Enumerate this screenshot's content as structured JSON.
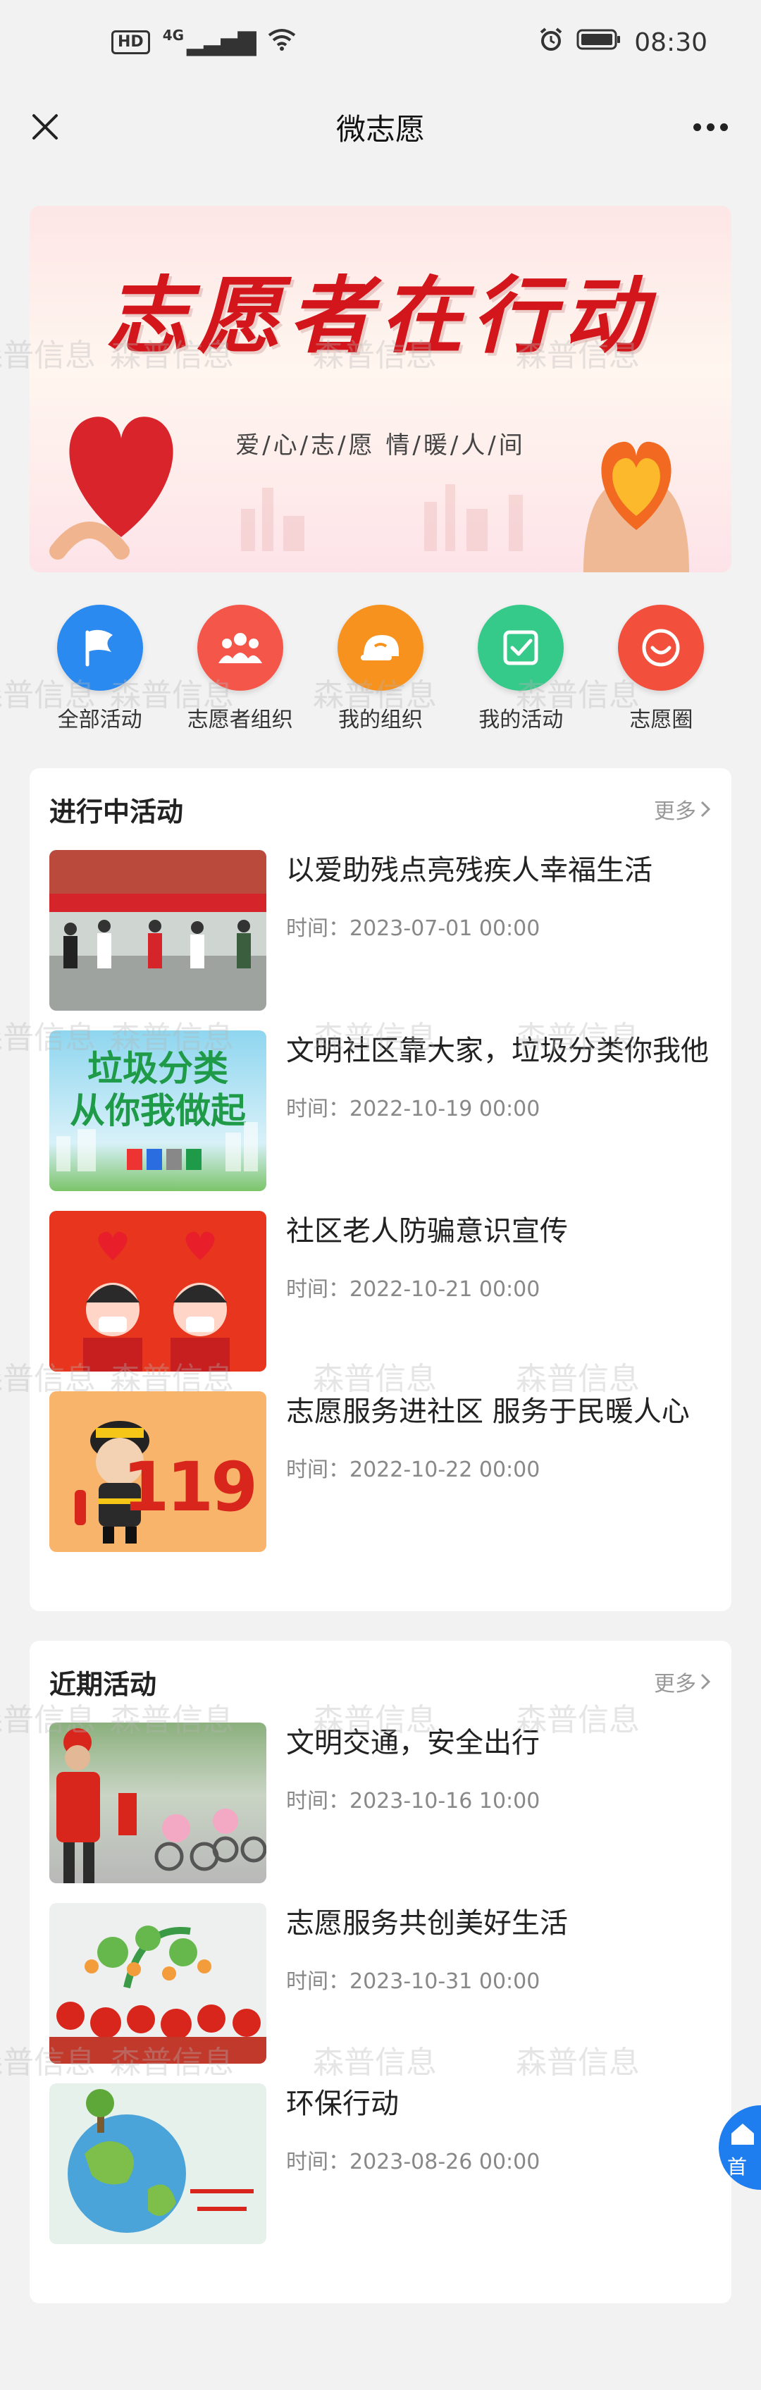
{
  "status_bar": {
    "hd": "HD",
    "network": "4G",
    "time": "08:30"
  },
  "nav": {
    "title": "微志愿"
  },
  "banner": {
    "title": "志愿者在行动",
    "subtitle": "爱/心/志/愿  情/暖/人/间"
  },
  "quick_links": [
    {
      "label": "全部活动",
      "color": "#2a8af0",
      "icon": "flag-icon"
    },
    {
      "label": "志愿者组织",
      "color": "#f5564a",
      "icon": "group-icon"
    },
    {
      "label": "我的组织",
      "color": "#f7921e",
      "icon": "helmet-icon"
    },
    {
      "label": "我的活动",
      "color": "#35c98a",
      "icon": "check-icon"
    },
    {
      "label": "志愿圈",
      "color": "#f24f3d",
      "icon": "smile-icon"
    }
  ],
  "ongoing": {
    "title": "进行中活动",
    "more": "更多",
    "items": [
      {
        "title": "以爱助残点亮残疾人幸福生活",
        "time": "时间：2023-07-01 00:00"
      },
      {
        "title": "文明社区靠大家，垃圾分类你我他",
        "time": "时间：2022-10-19 00:00"
      },
      {
        "title": "社区老人防骗意识宣传",
        "time": "时间：2022-10-21 00:00"
      },
      {
        "title": "志愿服务进社区 服务于民暖人心",
        "time": "时间：2022-10-22 00:00"
      }
    ]
  },
  "recent": {
    "title": "近期活动",
    "more": "更多",
    "items": [
      {
        "title": "文明交通，安全出行",
        "time": "时间：2023-10-16 10:00"
      },
      {
        "title": "志愿服务共创美好生活",
        "time": "时间：2023-10-31 00:00"
      },
      {
        "title": "环保行动",
        "time": "时间：2023-08-26 00:00"
      }
    ]
  },
  "thumb_text": {
    "garbage_line1": "垃圾分类",
    "garbage_line2": "从你我做起",
    "fire_number": "119"
  },
  "watermark": "森普信息",
  "fab": {
    "label": "首"
  }
}
